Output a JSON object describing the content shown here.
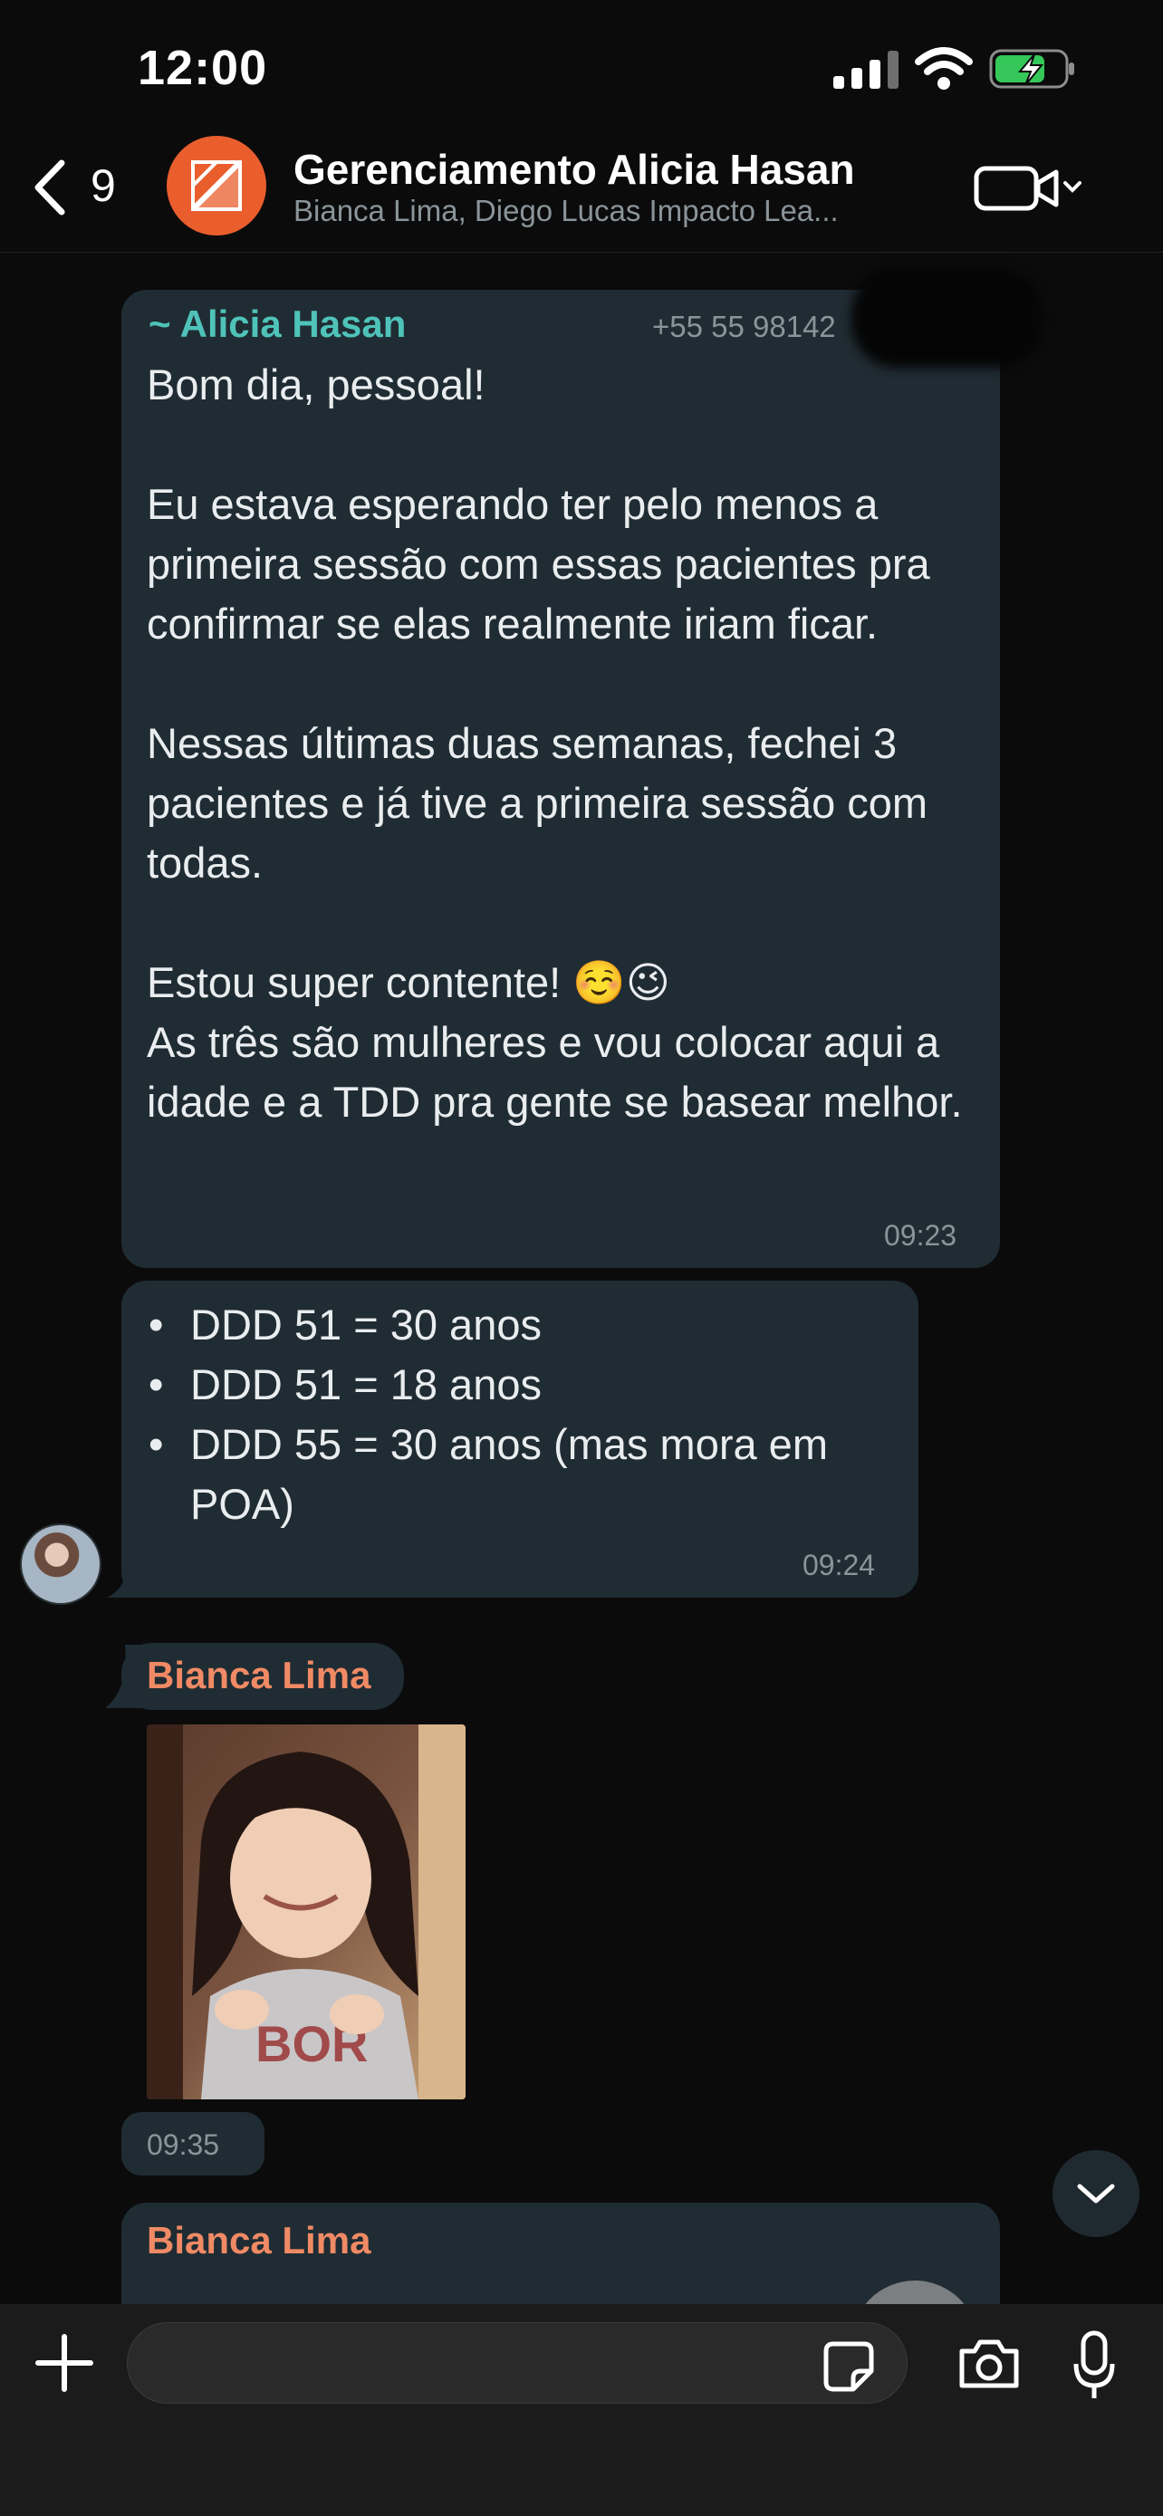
{
  "status_bar": {
    "time": "12:00"
  },
  "header": {
    "back_count": "9",
    "title": "Gerenciamento Alicia Hasan",
    "members": "Bianca Lima, Diego Lucas Impacto Lea...",
    "avatar_color": "#ea5e2e"
  },
  "messages": [
    {
      "sender": "~ Alicia Hasan",
      "phone": "+55 55 98142",
      "text": "Bom dia, pessoal!\n\nEu estava esperando ter pelo menos a primeira sessão com essas pacientes pra confirmar se elas realmente iriam ficar.\n\nNessas últimas duas semanas, fechei 3 pacientes e já tive a primeira sessão com todas.\n\nEstou super contente! ☺️😉\nAs três são mulheres e vou colocar aqui a idade e a TDD pra gente se basear melhor.",
      "time": "09:23",
      "sender_color": "#4fc3b9"
    },
    {
      "items": [
        "DDD 51 = 30 anos",
        "DDD 51 = 18 anos",
        "DDD 55 = 30 anos (mas mora em POA)"
      ],
      "time": "09:24"
    },
    {
      "sender": "Bianca Lima",
      "time": "09:35",
      "sender_color": "#f08a65"
    },
    {
      "sender": "Bianca Lima"
    }
  ],
  "colors": {
    "bubble": "#202c33",
    "background": "#0b0b0b",
    "composer": "#1b1b1b"
  }
}
